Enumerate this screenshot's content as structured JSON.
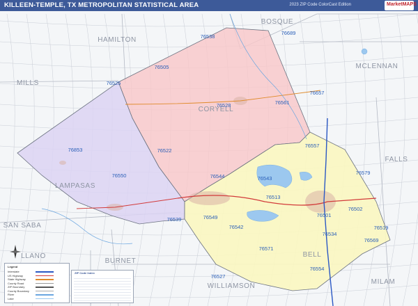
{
  "header": {
    "title": "KILLEEN-TEMPLE, TX METROPOLITAN STATISTICAL AREA",
    "edition": "2023 ZIP Code ColorCast Edition",
    "logo_text": "MarketMAPS"
  },
  "counties": [
    {
      "id": "hamilton",
      "name": "HAMILTON"
    },
    {
      "id": "bosque",
      "name": "BOSQUE"
    },
    {
      "id": "mills",
      "name": "MILLS"
    },
    {
      "id": "mclennan",
      "name": "MCLENNAN"
    },
    {
      "id": "coryell",
      "name": "CORYELL"
    },
    {
      "id": "falls",
      "name": "FALLS"
    },
    {
      "id": "lampasas",
      "name": "LAMPASAS"
    },
    {
      "id": "san-saba",
      "name": "SAN SABA"
    },
    {
      "id": "bell",
      "name": "BELL"
    },
    {
      "id": "llano",
      "name": "LLANO"
    },
    {
      "id": "burnet",
      "name": "BURNET"
    },
    {
      "id": "milam",
      "name": "MILAM"
    },
    {
      "id": "williamson",
      "name": "WILLIAMSON"
    }
  ],
  "zips": [
    "76538",
    "76689",
    "76525",
    "76528",
    "76561",
    "76657",
    "76853",
    "76522",
    "76550",
    "76544",
    "76543",
    "76557",
    "76579",
    "76513",
    "76539",
    "76549",
    "76542",
    "76502",
    "76501",
    "76519",
    "76534",
    "76569",
    "76571",
    "76554",
    "76527",
    "76505"
  ],
  "legend": {
    "title": "Legend",
    "items": [
      {
        "label": "Interstate",
        "color": "#2b58c4"
      },
      {
        "label": "US Highway",
        "color": "#d23a3a"
      },
      {
        "label": "State Highway",
        "color": "#e08a2a"
      },
      {
        "label": "County Road",
        "color": "#9a9a9a"
      },
      {
        "label": "ZIP Boundary",
        "color": "#555555"
      },
      {
        "label": "County Boundary",
        "color": "#aaaaaa"
      },
      {
        "label": "River",
        "color": "#6aa6e0"
      },
      {
        "label": "Lake",
        "color": "#9cc8ef"
      }
    ]
  },
  "ziplist": {
    "title": "ZIP Code Index"
  },
  "colors": {
    "coryell": "#f9c7c8",
    "lampasas": "#dcd3f3",
    "bell": "#fbf7c0",
    "background": "#f4f6f8",
    "water": "#9cc8ef"
  }
}
